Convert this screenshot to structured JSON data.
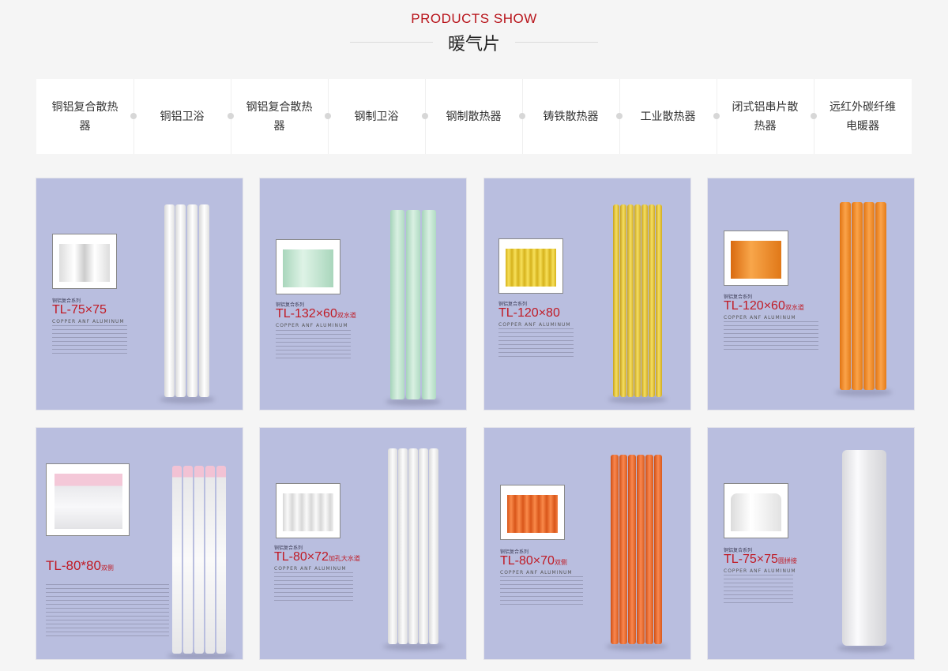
{
  "header": {
    "en_title": "PRODUCTS SHOW",
    "cn_title": "暖气片"
  },
  "tabs": [
    {
      "label": "铜铝复合散热器"
    },
    {
      "label": "铜铝卫浴"
    },
    {
      "label": "钢铝复合散热器"
    },
    {
      "label": "钢制卫浴"
    },
    {
      "label": "钢制散热器"
    },
    {
      "label": "铸铁散热器"
    },
    {
      "label": "工业散热器"
    },
    {
      "label": "闭式铝串片散热器"
    },
    {
      "label": "远红外碳纤维电暖器"
    }
  ],
  "products": [
    {
      "series": "铜铝复合系列",
      "model": "TL-75×75",
      "suffix": "",
      "sub": "COPPER  ANF  ALUMINUM",
      "color": "#f3f3f3",
      "fins": 4
    },
    {
      "series": "铜铝复合系列",
      "model": "TL-132×60",
      "suffix": "双水道",
      "sub": "COPPER  ANF  ALUMINUM",
      "color": "#bfe3cf",
      "fins": 3
    },
    {
      "series": "铜铝复合系列",
      "model": "TL-120×80",
      "suffix": "",
      "sub": "COPPER  ANF  ALUMINUM",
      "color": "#e9c53a",
      "fins": 7
    },
    {
      "series": "铜铝复合系列",
      "model": "TL-120×60",
      "suffix": "双水道",
      "sub": "COPPER  ANF  ALUMINUM",
      "color": "#ef8a1e",
      "fins": 4
    },
    {
      "series": "",
      "model": "TL-80*80",
      "suffix": "双侧",
      "sub": "",
      "color": "#f0eef0",
      "fins": 5
    },
    {
      "series": "铜铝复合系列",
      "model": "TL-80×72",
      "suffix": "加孔大水道",
      "sub": "COPPER  ANF  ALUMINUM",
      "color": "#eeeeee",
      "fins": 5
    },
    {
      "series": "铜铝复合系列",
      "model": "TL-80×70",
      "suffix": "双侧",
      "sub": "COPPER  ANF  ALUMINUM",
      "color": "#e8641e",
      "fins": 6
    },
    {
      "series": "铜铝复合系列",
      "model": "TL-75×75",
      "suffix": "圆拼接",
      "sub": "COPPER  ANF  ALUMINUM",
      "color": "#f4f4f6",
      "fins": 1
    }
  ]
}
